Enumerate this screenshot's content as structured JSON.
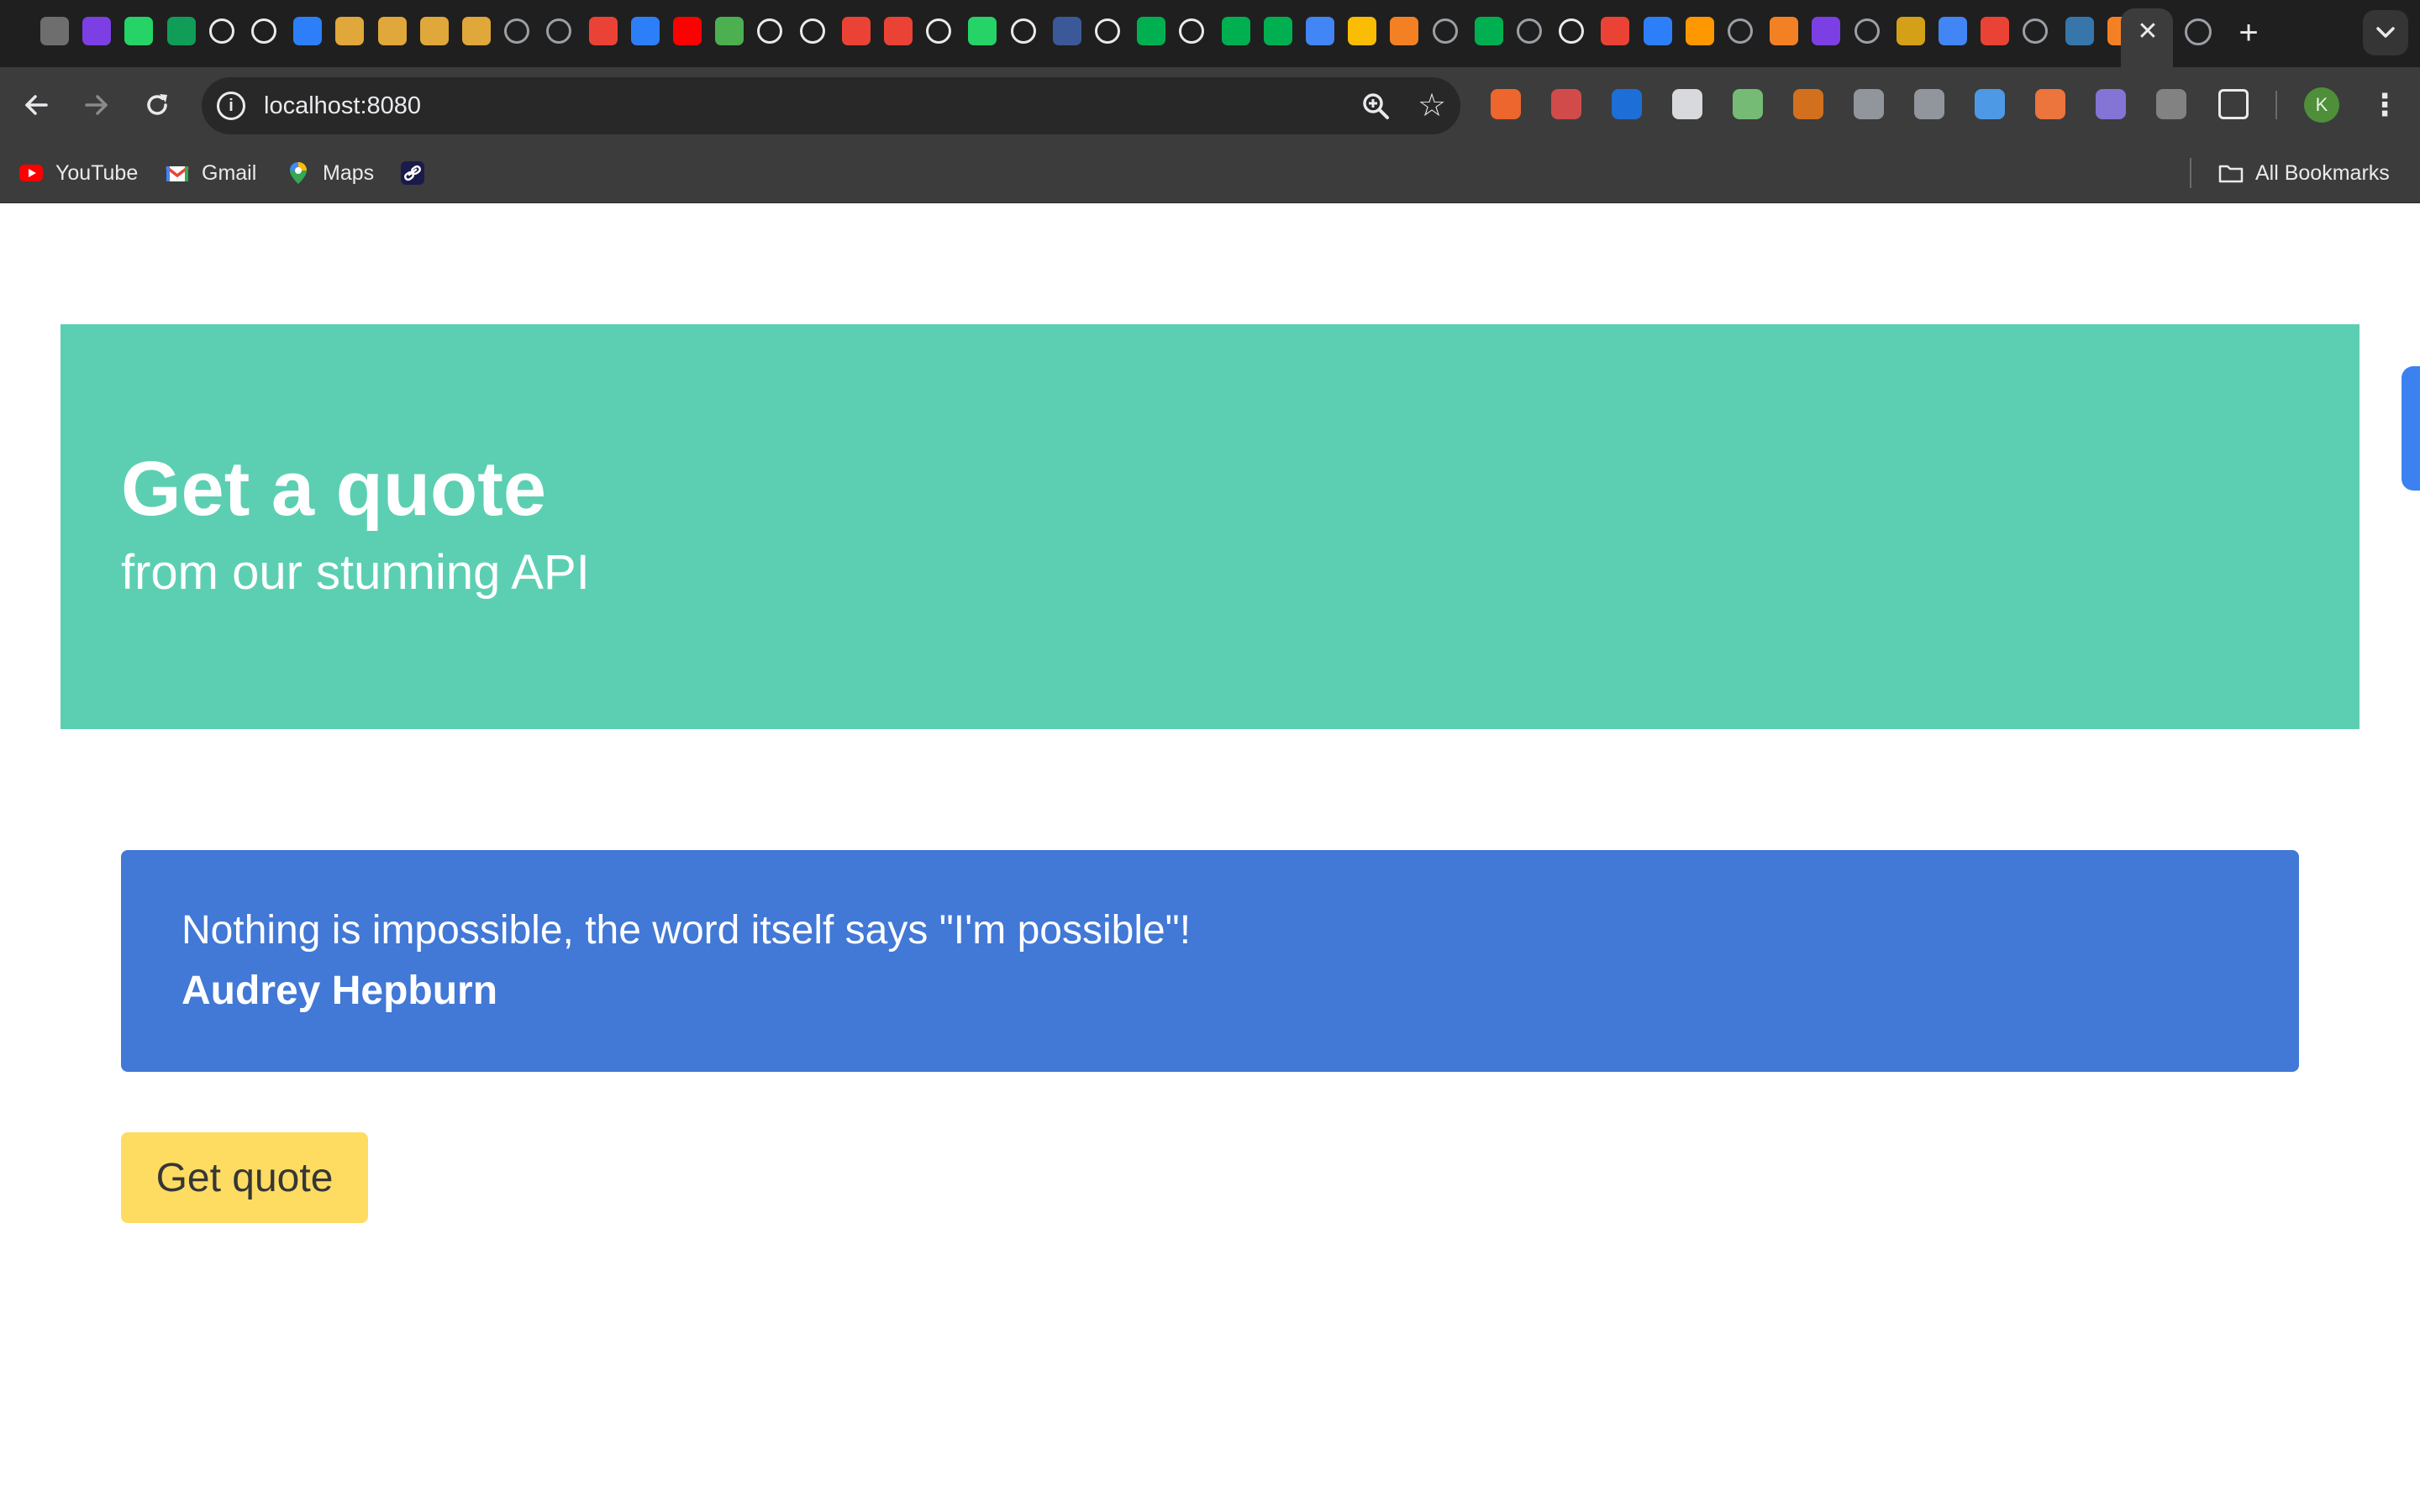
{
  "browser": {
    "url": "localhost:8080",
    "avatar_letter": "K",
    "tab_close_glyph": "✕",
    "new_tab_glyph": "+",
    "menu_glyph": "⋮",
    "star_glyph": "☆",
    "info_glyph": "i",
    "bookmarks": [
      {
        "label": "YouTube",
        "icon": "youtube-icon"
      },
      {
        "label": "Gmail",
        "icon": "gmail-icon"
      },
      {
        "label": "Maps",
        "icon": "maps-icon"
      },
      {
        "label": "",
        "icon": "link-icon"
      }
    ],
    "all_bookmarks_label": "All Bookmarks",
    "colors": {
      "tabstrip": "#1f1f1f",
      "toolbar": "#3c3c3c",
      "omnibox": "#282828"
    }
  },
  "hero": {
    "title": "Get a quote",
    "subtitle": "from our stunning API",
    "background": "#5ccfb2"
  },
  "quote": {
    "text": "Nothing is impossible, the word itself says \"I'm possible\"!",
    "author": "Audrey Hepburn",
    "background": "#4278d6"
  },
  "actions": {
    "get_quote_label": "Get quote",
    "button_color": "#fedc62"
  }
}
